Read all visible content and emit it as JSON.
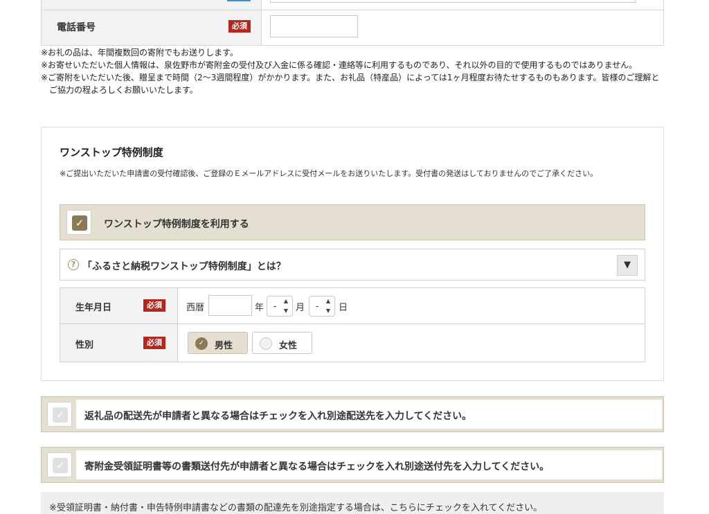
{
  "phone": {
    "label": "電話番号",
    "required": "必須",
    "value": ""
  },
  "notes": [
    "※お礼の品は、年間複数回の寄附でもお送りします。",
    "※お寄せいただいた個人情報は、泉佐野市が寄附金の受付及び入金に係る確認・連絡等に利用するものであり、それ以外の目的で使用するものではありません。",
    "※ご寄附をいただいた後、贈呈まで時間（2〜3週間程度）がかかります。また、お礼品（特産品）によっては1ヶ月程度お待たせするものもあります。皆様のご理解とご協力の程よろしくお願いいたします。"
  ],
  "onestop": {
    "title": "ワンストップ特例制度",
    "description": "※ご提出いただいた申請書の受付確認後、ご登録のＥメールアドレスに受付メールをお送りいたします。受付書の発送はしておりませんのでご了承ください。",
    "checkbox_label": "ワンストップ特例制度を利用する",
    "checkbox_checked": true,
    "accordion_label": "「ふるさと納税ワンストップ特例制度」とは？",
    "accordion_button": "▼",
    "birth": {
      "label": "生年月日",
      "required": "必須",
      "era": "西暦",
      "year_value": "",
      "year_unit": "年",
      "month_value": "-",
      "month_unit": "月",
      "day_value": "-",
      "day_unit": "日"
    },
    "gender": {
      "label": "性別",
      "required": "必須",
      "options": [
        "男性",
        "女性"
      ],
      "selected": "男性"
    }
  },
  "bars": [
    {
      "label": "返礼品の配送先が申請者と異なる場合はチェックを入れ別途配送先を入力してください。",
      "checked": false
    },
    {
      "label": "寄附金受領証明書等の書類送付先が申請者と異なる場合はチェックを入れ別途送付先を入力してください。",
      "checked": false
    }
  ],
  "bottom_note": "※受領証明書・納付書・申告特例申請書などの書類の配達先を別途指定する場合は、こちらにチェックを入れてください。",
  "colors": {
    "required_bg": "#b5261e",
    "accent": "#8b7a55",
    "check_bg": "#e4dfd0"
  }
}
